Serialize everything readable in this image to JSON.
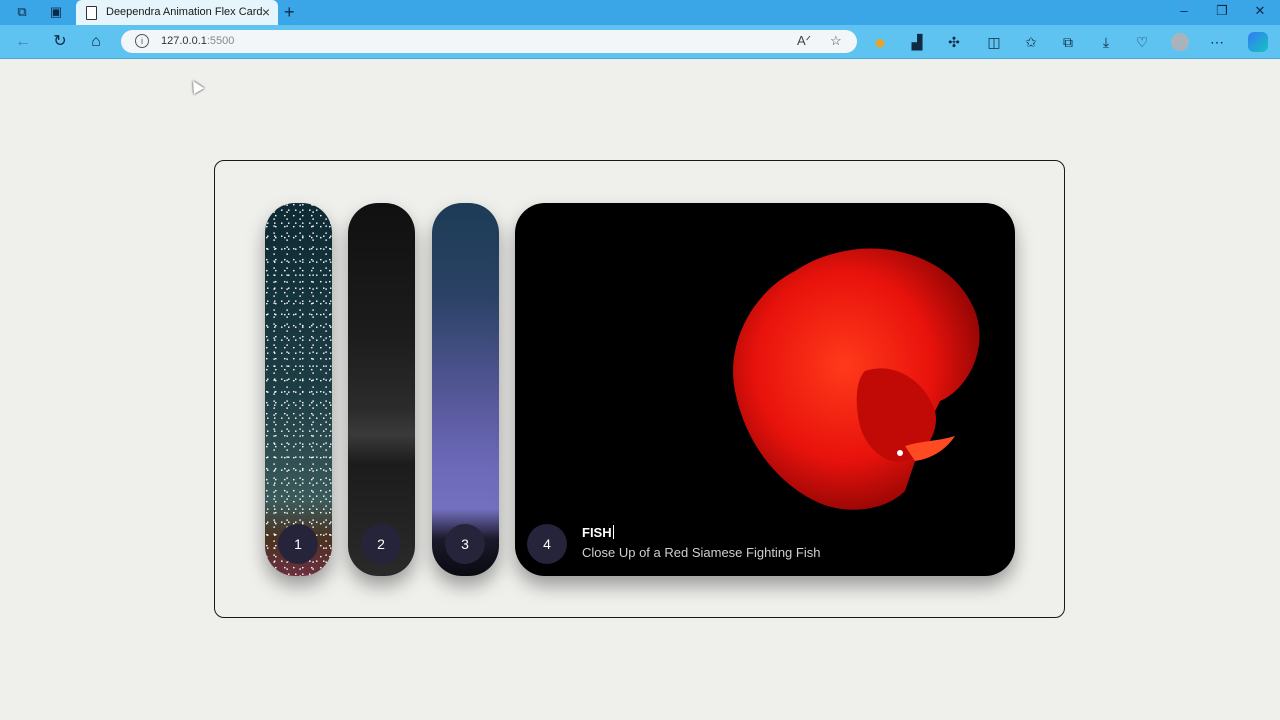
{
  "browser": {
    "tab_title": "Deependra Animation Flex Card",
    "url_host": "127.0.0.1",
    "url_port": ":5500"
  },
  "cards": [
    {
      "number": "1",
      "theme": "starry-night"
    },
    {
      "number": "2",
      "theme": "dark-keyboard"
    },
    {
      "number": "3",
      "theme": "tree-sunset"
    },
    {
      "number": "4",
      "theme": "red-fish",
      "title": "FISH",
      "subtitle": "Close Up of a Red Siamese Fighting Fish"
    }
  ],
  "colors": {
    "titlebar": "#3aa6e8",
    "toolbar": "#5ec3f0",
    "page_bg": "#efefec",
    "badge_bg": "#25243a",
    "fish": "#e8120c"
  }
}
